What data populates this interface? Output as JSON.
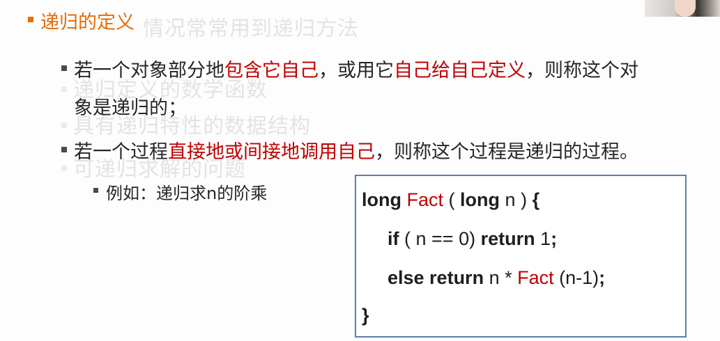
{
  "ghost": {
    "heading": "情况常常用到递归方法",
    "line1": "递归定义的数学函数",
    "line2": "具有递归特性的数据结构",
    "line3": "可递归求解的问题"
  },
  "title": "递归的定义",
  "point1": {
    "a": "若一个对象部分地",
    "b": "包含它自己",
    "c": "，或用它",
    "d": "自己给自己定义",
    "e": "，则称这个对",
    "f": "象是递归的；"
  },
  "point2": {
    "a": "若一个过程",
    "b": "直接地或间接地调用自己",
    "c": "，则称这个过程是递归的过程。"
  },
  "example": "例如：递归求n的阶乘",
  "code": {
    "l1_kw1": "long",
    "l1_fn": "Fact",
    "l1_p1": "(",
    "l1_kw2": "long",
    "l1_var": "n )",
    "l1_brace": "{",
    "l2_kw": "if",
    "l2_cond": "( n == 0)",
    "l2_ret": "return",
    "l2_val": "1",
    "l2_semi": ";",
    "l3_kw": "else return",
    "l3_n": "n *",
    "l3_fn": "Fact",
    "l3_arg": "(n-1)",
    "l3_semi": ";",
    "l4_brace": "}"
  },
  "colors": {
    "accent_orange": "#e46c0a",
    "emphasis_red": "#c00000",
    "code_border": "#5b7fa6"
  }
}
